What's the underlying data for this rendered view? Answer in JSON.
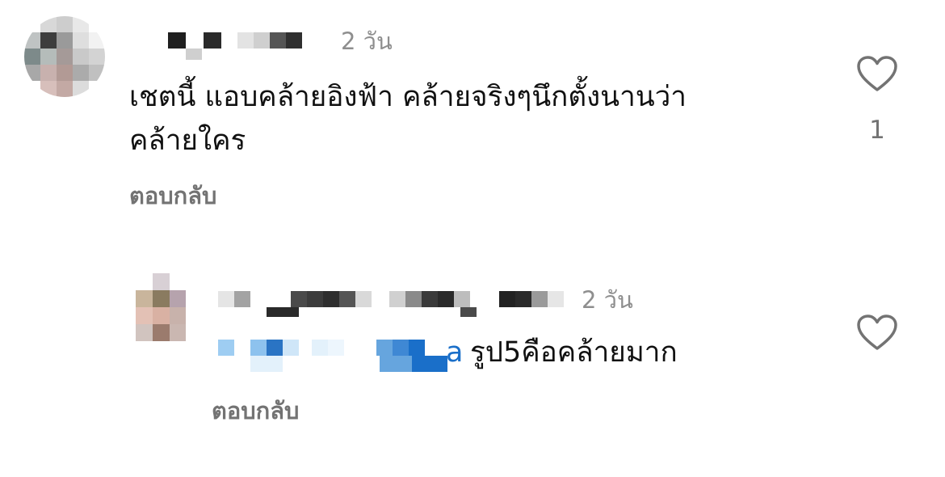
{
  "comments": [
    {
      "time": "2 วัน",
      "text_line1": "เชตนี้ แอบคล้ายอิงฟ้า คล้ายจริงๆนึกตั้งนานว่า",
      "text_line2": "คล้ายใคร",
      "reply_label": "ตอบกลับ",
      "like_count": "1",
      "like_icon": "heart-outline-icon"
    },
    {
      "time": "2 วัน",
      "mention_tail": "a",
      "text": "รูป5คือคล้ายมาก",
      "reply_label": "ตอบกลับ",
      "like_icon": "heart-outline-icon"
    }
  ],
  "colors": {
    "text": "#111111",
    "muted": "#8e8e8e",
    "reply": "#737373",
    "mention": "#1a6fc9"
  }
}
